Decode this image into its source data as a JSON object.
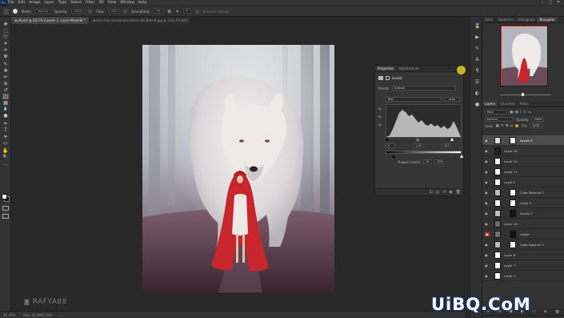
{
  "menubar": {
    "logo": "Ps",
    "items": [
      "File",
      "Edit",
      "Image",
      "Layer",
      "Type",
      "Select",
      "Filter",
      "3D",
      "View",
      "Window",
      "Help"
    ],
    "window_controls": [
      "–",
      "□",
      "✕"
    ]
  },
  "options_bar": {
    "mode_label": "Mode:",
    "mode_value": "Normal",
    "opacity_label": "Opacity:",
    "opacity_value": "100%",
    "flow_label": "Flow:",
    "flow_value": "45%",
    "smoothing_label": "Smoothing:",
    "smoothing_value": "0%",
    "angle_value": "0°",
    "hint": "Erase to History"
  },
  "tabs": [
    {
      "label": "wolf.psd @ 26.5% (Levels 3, Layer Mask/8) *",
      "active": true
    },
    {
      "label": "works-2-to-stardand/untitled-sRGB/bold.jpg @ 25% (RGB/8)",
      "active": false
    }
  ],
  "toolbar": {
    "icons": [
      "move-icon",
      "marquee-icon",
      "lasso-icon",
      "quick-select-icon",
      "crop-icon",
      "frame-icon",
      "eyedropper-icon",
      "healing-icon",
      "brush-icon",
      "stamp-icon",
      "history-brush-icon",
      "eraser-icon",
      "gradient-icon",
      "blur-icon",
      "dodge-icon",
      "pen-icon",
      "type-icon",
      "path-select-icon",
      "shape-icon",
      "hand-icon",
      "zoom-icon",
      "more-icon"
    ],
    "glyphs": [
      "✥",
      "⬚",
      "➰",
      "✦",
      "⌗",
      "⊠",
      "✎",
      "✚",
      "✏",
      "⊕",
      "↺",
      "◫",
      "▦",
      "💧",
      "●",
      "✒",
      "T",
      "➤",
      "▭",
      "✋",
      "🔍",
      "…"
    ]
  },
  "canvas": {
    "watermark": "RAFYA88"
  },
  "properties": {
    "tabs": [
      "Properties",
      "Adjustments"
    ],
    "title": "Levels",
    "preset_label": "Preset:",
    "preset_value": "Custom",
    "channel_value": "Red",
    "auto_label": "Auto",
    "input_black": "0",
    "input_gamma": "1.00",
    "input_white": "221",
    "output_label": "Output Levels:",
    "output_black": "35",
    "output_white": "255",
    "footer_icons": [
      "clip-icon",
      "eye-prev-icon",
      "reset-icon",
      "visibility-icon",
      "trash-icon"
    ]
  },
  "status": {
    "zoom": "26.49%",
    "doc": "Doc: 22.8M/2.50G"
  },
  "right_panel": {
    "top_tabs": [
      "Color",
      "Swatches",
      "Histogram",
      "Navigator"
    ],
    "layer_tabs": [
      "Layers",
      "Channels",
      "Paths"
    ],
    "filter_label": "Kind",
    "blend_mode": "Normal",
    "opacity_label": "Opacity:",
    "opacity_value": "100%",
    "lock_label": "Lock:",
    "fill_label": "Fill:",
    "fill_value": "100%",
    "layers": [
      {
        "name": "Levels 3",
        "type": "adjustment",
        "selected": true
      },
      {
        "name": "Layer 18",
        "type": "pixel"
      },
      {
        "name": "Layer 14",
        "type": "pixel"
      },
      {
        "name": "Layer 11",
        "type": "pixel"
      },
      {
        "name": "Layer 5",
        "type": "pixel"
      },
      {
        "name": "Color Balance 1",
        "type": "adjustment"
      },
      {
        "name": "Layer 3",
        "type": "pixel"
      },
      {
        "name": "Levels 1",
        "type": "adjustment"
      },
      {
        "name": "Layer 16",
        "type": "pixel"
      },
      {
        "name": "model",
        "type": "pixel"
      },
      {
        "name": "Color Balance 2",
        "type": "adjustment"
      },
      {
        "name": "Layer 8",
        "type": "pixel"
      },
      {
        "name": "Layer 7",
        "type": "pixel"
      },
      {
        "name": "Layer 1",
        "type": "pixel"
      }
    ]
  },
  "site_watermark": "UiBQ.CoM"
}
